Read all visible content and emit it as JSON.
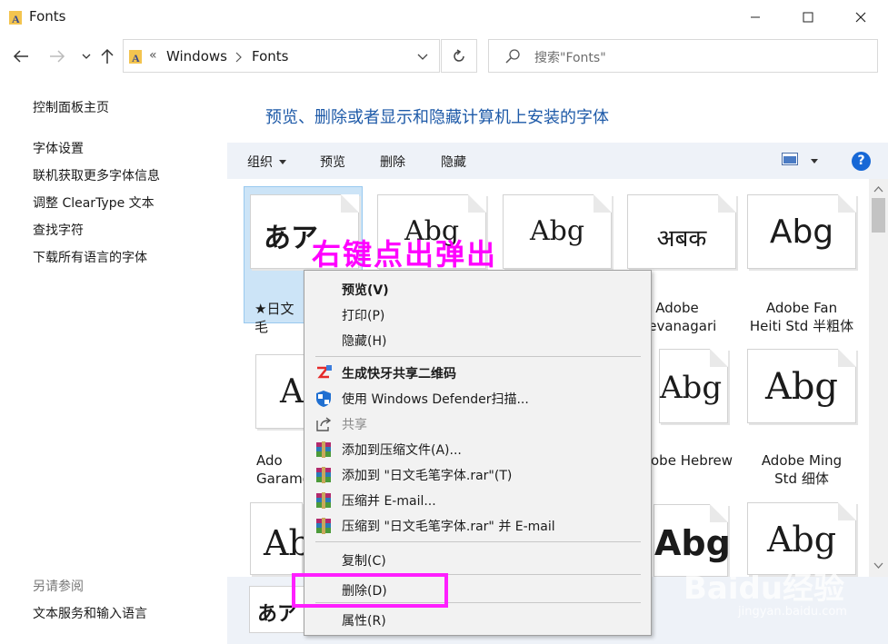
{
  "window": {
    "title": "Fonts"
  },
  "address": {
    "crumbs": [
      "Windows",
      "Fonts"
    ],
    "overflow": "«"
  },
  "search": {
    "placeholder": "搜索\"Fonts\""
  },
  "left_pane": {
    "home": "控制面板主页",
    "links": [
      "字体设置",
      "联机获取更多字体信息",
      "调整 ClearType 文本",
      "查找字符",
      "下载所有语言的字体"
    ],
    "see_also_head": "另请参阅",
    "see_also": [
      "文本服务和输入语言"
    ]
  },
  "main": {
    "heading": "预览、删除或者显示和隐藏计算机上安装的字体"
  },
  "toolbar": {
    "organize": "组织",
    "preview": "预览",
    "delete": "删除",
    "hide": "隐藏"
  },
  "fonts": [
    {
      "sample": "あア",
      "caption": "★日文毛"
    },
    {
      "sample": "Abg",
      "caption": ""
    },
    {
      "sample": "Abg",
      "caption": ""
    },
    {
      "sample": "अबक",
      "caption": "Adobe\nDevanagari"
    },
    {
      "sample": "Abg",
      "caption": "Adobe Fan\nHeiti Std 半粗体"
    },
    {
      "sample": "A",
      "caption": "Ado\nGaramo"
    },
    {
      "sample": "Abg",
      "caption": "obe Hebrew"
    },
    {
      "sample": "Abg",
      "caption": "Adobe Ming\nStd 细体"
    },
    {
      "sample": "Ab",
      "caption": ""
    },
    {
      "sample": "Abg",
      "caption": ""
    },
    {
      "sample": "Abg",
      "caption": ""
    }
  ],
  "context_menu": {
    "preview": "预览(V)",
    "print": "打印(P)",
    "hide": "隐藏(H)",
    "qr_share": "生成快牙共享二维码",
    "defender": "使用 Windows Defender扫描...",
    "share": "共享",
    "add_archive": "添加到压缩文件(A)...",
    "add_rar": "添加到 \"日文毛笔字体.rar\"(T)",
    "zip_email": "压缩并 E-mail...",
    "zip_rar_email": "压缩到 \"日文毛笔字体.rar\" 并 E-mail",
    "copy": "复制(C)",
    "delete": "删除(D)",
    "properties": "属性(R)"
  },
  "annotation": {
    "text": "右键点出弹出"
  },
  "details_preview": {
    "sample": "あア"
  },
  "watermark": {
    "main": "Baidu经验",
    "sub": "jingyan.baidu.com"
  },
  "colors": {
    "accent": "#1e5aa8",
    "annotation": "#ff00ff",
    "selection": "#cce4f7"
  }
}
